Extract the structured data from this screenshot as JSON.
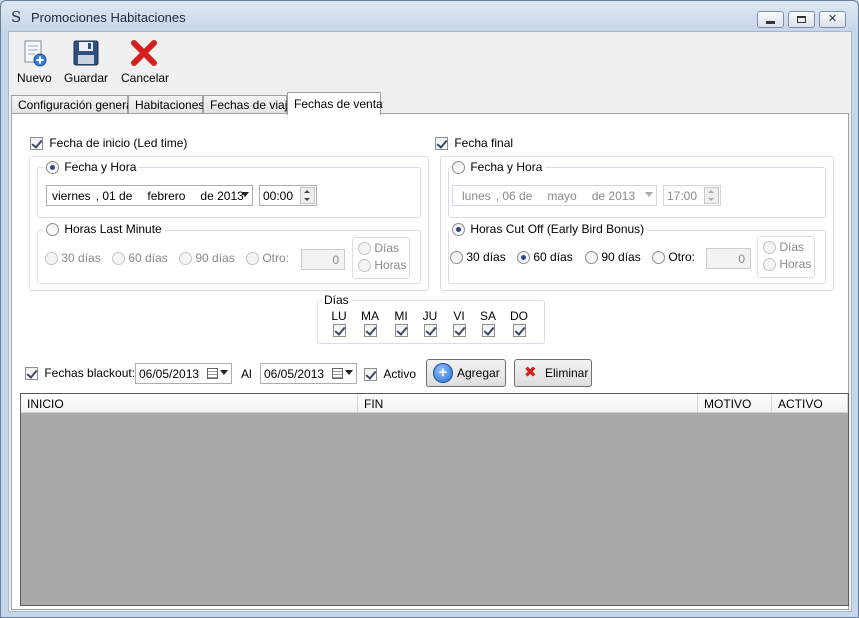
{
  "window": {
    "title": "Promociones Habitaciones",
    "app_icon": "S"
  },
  "toolbar": {
    "new_label": "Nuevo",
    "save_label": "Guardar",
    "cancel_label": "Cancelar"
  },
  "tabs": [
    {
      "label": "Configuración general"
    },
    {
      "label": "Habitaciones"
    },
    {
      "label": "Fechas de viaje"
    },
    {
      "label": "Fechas de venta",
      "active": true
    }
  ],
  "start": {
    "checkbox_label": "Fecha de inicio (Led time)",
    "checked": true,
    "datetime_radio": "Fecha y Hora",
    "date": {
      "weekday": "viernes",
      "day": ", 01 de",
      "month": "febrero",
      "year": "de 2013"
    },
    "time": "00:00",
    "lastminute_radio": "Horas Last Minute",
    "options": [
      "30 días",
      "60 días",
      "90 días",
      "Otro:"
    ],
    "other_value": "0",
    "unit_days": "Días",
    "unit_hours": "Horas"
  },
  "end": {
    "checkbox_label": "Fecha final",
    "checked": true,
    "datetime_radio": "Fecha y Hora",
    "date": {
      "weekday": "lunes",
      "day": ", 06 de",
      "month": "mayo",
      "year": "de 2013"
    },
    "time": "17:00",
    "cutoff_radio": "Horas Cut Off (Early Bird Bonus)",
    "options": [
      "30 días",
      "60 días",
      "90 días",
      "Otro:"
    ],
    "selected_option": "60 días",
    "other_value": "0",
    "unit_days": "Días",
    "unit_hours": "Horas"
  },
  "days": {
    "legend": "Días",
    "labels": [
      "LU",
      "MA",
      "MI",
      "JU",
      "VI",
      "SA",
      "DO"
    ]
  },
  "blackout": {
    "checkbox_label": "Fechas blackout:",
    "from": "06/05/2013",
    "to_label": "Al",
    "to": "06/05/2013",
    "active_label": "Activo",
    "add_label": "Agregar",
    "delete_label": "Eliminar"
  },
  "grid": {
    "columns": [
      "INICIO",
      "FIN",
      "MOTIVO",
      "ACTIVO"
    ]
  },
  "colors": {
    "accent": "#2c4a8c",
    "grid_bg": "#a9a9a9",
    "delete_red": "#d42020"
  }
}
